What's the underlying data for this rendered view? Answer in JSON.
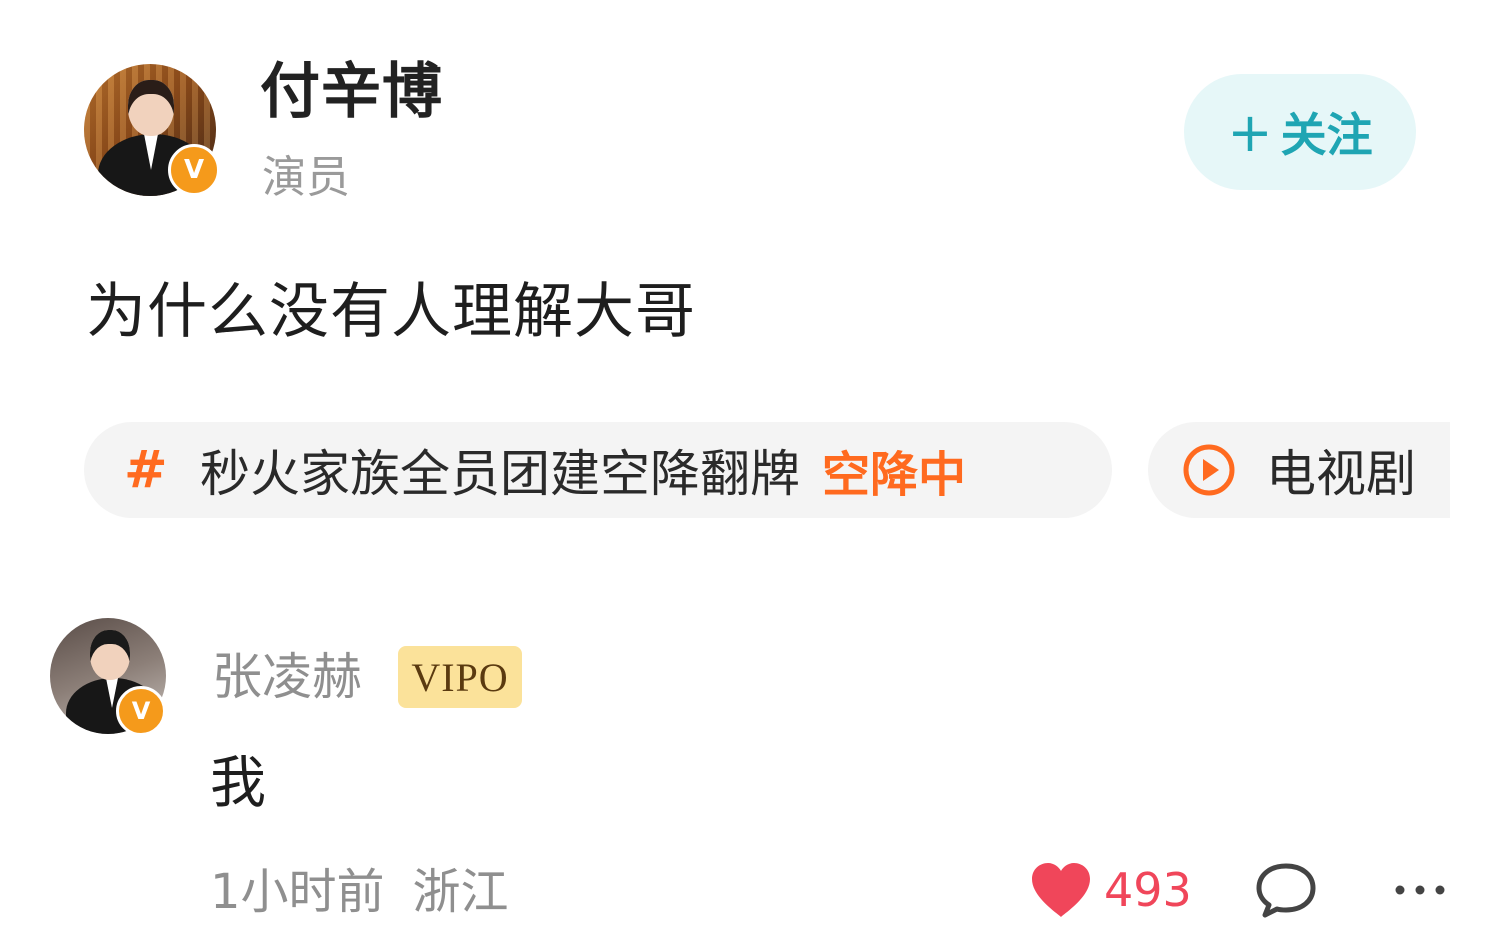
{
  "author": {
    "name": "付辛博",
    "title": "演员",
    "verified_badge": "V",
    "avatar_icon": "verified-avatar"
  },
  "follow": {
    "plus": "+",
    "label": "关注",
    "color": "#1fa5b3",
    "background": "#e6f7f8"
  },
  "post": {
    "text": "为什么没有人理解大哥"
  },
  "topic": {
    "icon": "#",
    "label": "秒火家族全员团建空降翻牌",
    "status": "空降中",
    "accent_color": "#ff6a1f"
  },
  "tv_chip": {
    "icon": "play-circle-icon",
    "label": "电视剧"
  },
  "comment": {
    "user_name": "张凌赫",
    "vip_label": "VIPO",
    "verified_badge": "V",
    "text": "我",
    "time": "1小时前",
    "location": "浙江",
    "like_count": "493",
    "like_color": "#f0465a"
  },
  "colors": {
    "verified_badge": "#f59a1b",
    "vip_badge": "#fbe29a",
    "secondary_text": "#8f8f8f"
  }
}
